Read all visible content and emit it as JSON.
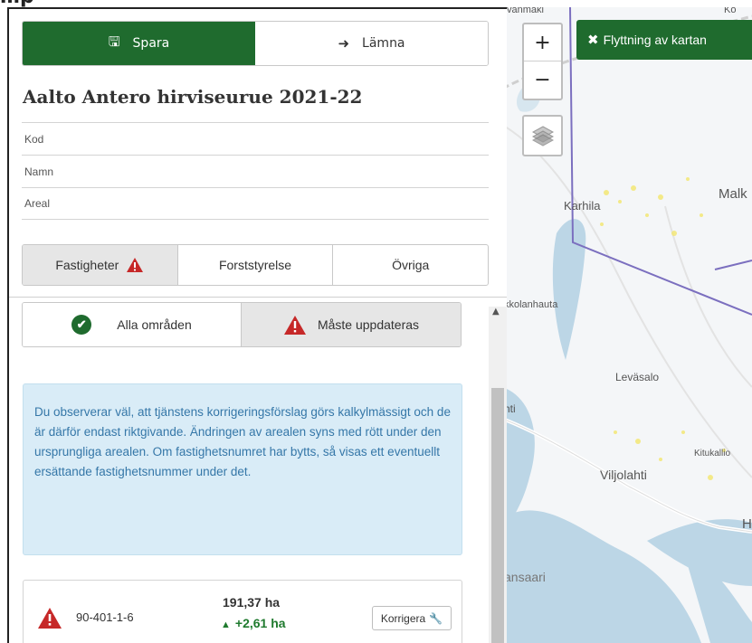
{
  "top_heading": "…p",
  "map": {
    "labels": {
      "vanmaki": "vanmäki",
      "ko": "Ko",
      "karhila": "Karhila",
      "malk": "Malk",
      "kkolanhauta": "kkolanhauta",
      "levasalo": "Leväsalo",
      "hti": "hti",
      "kitukall": "Kitukallio",
      "viljolahti": "Viljolahti",
      "h": "H",
      "ansaari": "ansaari"
    },
    "zoom_in": "+",
    "zoom_out": "−",
    "move_map_label": "Flyttning av kartan",
    "move_map_icon": "✖"
  },
  "panel": {
    "save_label": "Spara",
    "save_icon": "🖫",
    "leave_label": "Lämna",
    "leave_icon": "➜",
    "title": "Aalto Antero hirviseurue 2021-22",
    "fields": {
      "code": "Kod",
      "name": "Namn",
      "area": "Areal"
    },
    "tabs": {
      "properties": "Fastigheter",
      "forest_board": "Forststyrelse",
      "other": "Övriga"
    },
    "filter": {
      "all": "Alla områden",
      "must_update": "Måste uppdateras",
      "check_icon": "✔"
    },
    "info_text": "Du observerar väl, att tjänstens korrigeringsförslag görs kalkylmässigt och de är därför endast riktgivande. Ändringen av arealen syns med rött under den ursprungliga arealen. Om fastighetsnumret har bytts, så visas ett eventuellt ersättande fastighetsnummer under det.",
    "property": {
      "id": "90-401-1-6",
      "area": "191,37 ha",
      "change": "+2,61 ha",
      "up_icon": "▲",
      "correct_label": "Korrigera",
      "wrench_icon": "🔧"
    }
  },
  "colors": {
    "brand_green": "#1f6b2e",
    "warning_red": "#c62828",
    "info_blue_bg": "#d9ecf7",
    "info_blue_text": "#3577a8",
    "change_green": "#1f7a2e"
  }
}
